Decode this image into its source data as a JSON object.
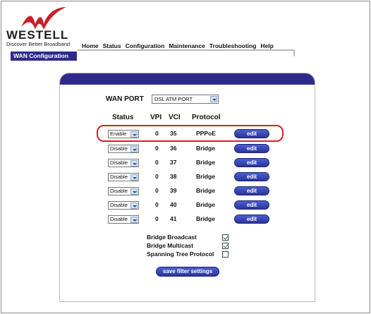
{
  "brand": {
    "name": "WESTELL",
    "tagline": "Discover  Better  Broadband"
  },
  "nav": [
    "Home",
    "Status",
    "Configuration",
    "Maintenance",
    "Troubleshooting",
    "Help"
  ],
  "section_tab": "WAN Configuration",
  "wan_port": {
    "label": "WAN PORT",
    "selected": "DSL ATM PORT"
  },
  "table": {
    "headers": {
      "status": "Status",
      "vpi": "VPI",
      "vci": "VCI",
      "protocol": "Protocol"
    },
    "rows": [
      {
        "status": "Enable",
        "vpi": "0",
        "vci": "35",
        "protocol": "PPPoE",
        "edit": "edit"
      },
      {
        "status": "Disable",
        "vpi": "0",
        "vci": "36",
        "protocol": "Bridge",
        "edit": "edit"
      },
      {
        "status": "Disable",
        "vpi": "0",
        "vci": "37",
        "protocol": "Bridge",
        "edit": "edit"
      },
      {
        "status": "Disable",
        "vpi": "0",
        "vci": "38",
        "protocol": "Bridge",
        "edit": "edit"
      },
      {
        "status": "Disable",
        "vpi": "0",
        "vci": "39",
        "protocol": "Bridge",
        "edit": "edit"
      },
      {
        "status": "Disable",
        "vpi": "0",
        "vci": "40",
        "protocol": "Bridge",
        "edit": "edit"
      },
      {
        "status": "Disable",
        "vpi": "0",
        "vci": "41",
        "protocol": "Bridge",
        "edit": "edit"
      }
    ]
  },
  "options": [
    {
      "label": "Bridge Broadcast",
      "checked": true
    },
    {
      "label": "Bridge Multicast",
      "checked": true
    },
    {
      "label": "Spanning Tree Protocol",
      "checked": false
    }
  ],
  "save_button": "save filter settings",
  "colors": {
    "brand_red": "#c8202b",
    "nav_blue": "#2e2a8c",
    "button_blue": "#2a359b",
    "highlight_red": "#d1232a"
  },
  "icons": [
    "westell-logo-icon",
    "chevron-down-icon",
    "checkmark-icon"
  ]
}
